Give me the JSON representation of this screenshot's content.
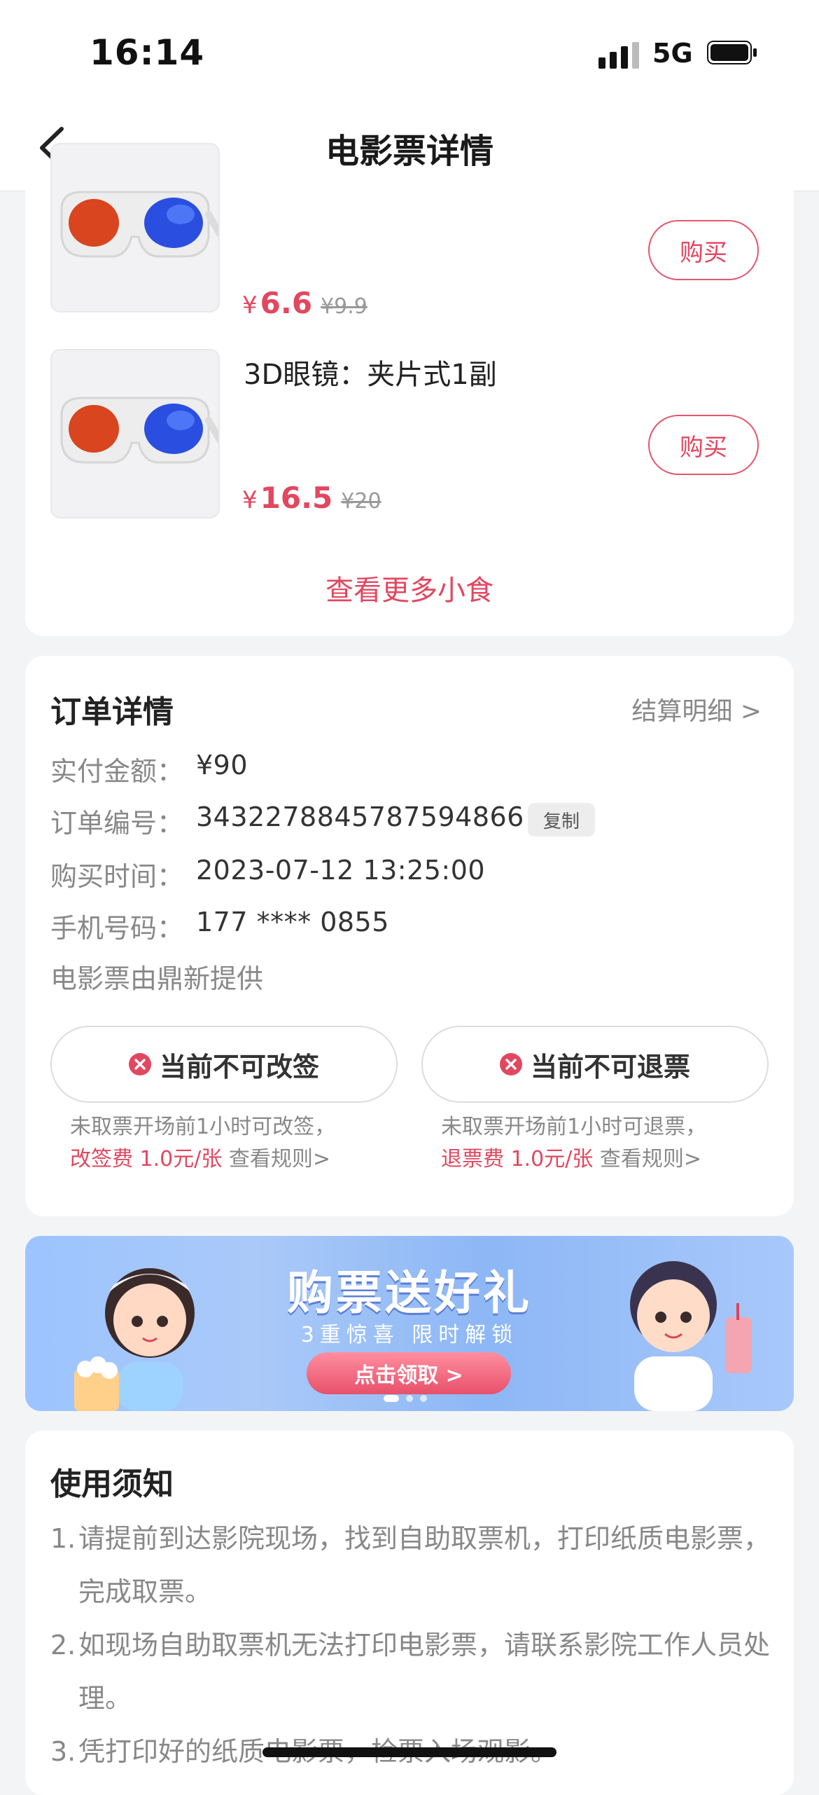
{
  "status_bar": {
    "time": "16:14",
    "network": "5G"
  },
  "nav": {
    "title": "电影票详情"
  },
  "snacks": {
    "items": [
      {
        "name": "",
        "price_symbol": "¥",
        "price": "6.6",
        "original_price": "¥9.9",
        "buy_label": "购买"
      },
      {
        "name": "3D眼镜：夹片式1副",
        "price_symbol": "¥",
        "price": "16.5",
        "original_price": "¥20",
        "buy_label": "购买"
      }
    ],
    "more_label": "查看更多小食"
  },
  "order": {
    "title": "订单详情",
    "settlement_link": "结算明细 >",
    "rows": [
      {
        "label": "实付金额：",
        "value": "¥90"
      },
      {
        "label": "订单编号：",
        "value": "3432278845787594866"
      },
      {
        "label": "购买时间：",
        "value": "2023-07-12 13:25:00"
      },
      {
        "label": "手机号码：",
        "value": "177 **** 0855"
      }
    ],
    "copy_label": "复制",
    "provider": "电影票由鼎新提供",
    "change": {
      "label": "当前不可改签",
      "note_line1": "未取票开场前1小时可改签，",
      "fee": "改签费 1.0元/张",
      "rules": " 查看规则>"
    },
    "refund": {
      "label": "当前不可退票",
      "note_line1": "未取票开场前1小时可退票，",
      "fee": "退票费 1.0元/张",
      "rules": " 查看规则>"
    }
  },
  "banner": {
    "title": "购票送好礼",
    "subtitle": "3重惊喜 限时解锁",
    "button": "点击领取 >"
  },
  "notice": {
    "title": "使用须知",
    "items": [
      {
        "idx": "1.",
        "text": "请提前到达影院现场，找到自助取票机，打印纸质电影票，完成取票。"
      },
      {
        "idx": "2.",
        "text": "如现场自助取票机无法打印电影票，请联系影院工作人员处理。"
      },
      {
        "idx": "3.",
        "text": "凭打印好的纸质电影票，检票入场观影。"
      }
    ]
  },
  "colors": {
    "accent": "#e2475f",
    "background": "#f3f4f6",
    "card": "#ffffff",
    "muted": "#888888"
  }
}
